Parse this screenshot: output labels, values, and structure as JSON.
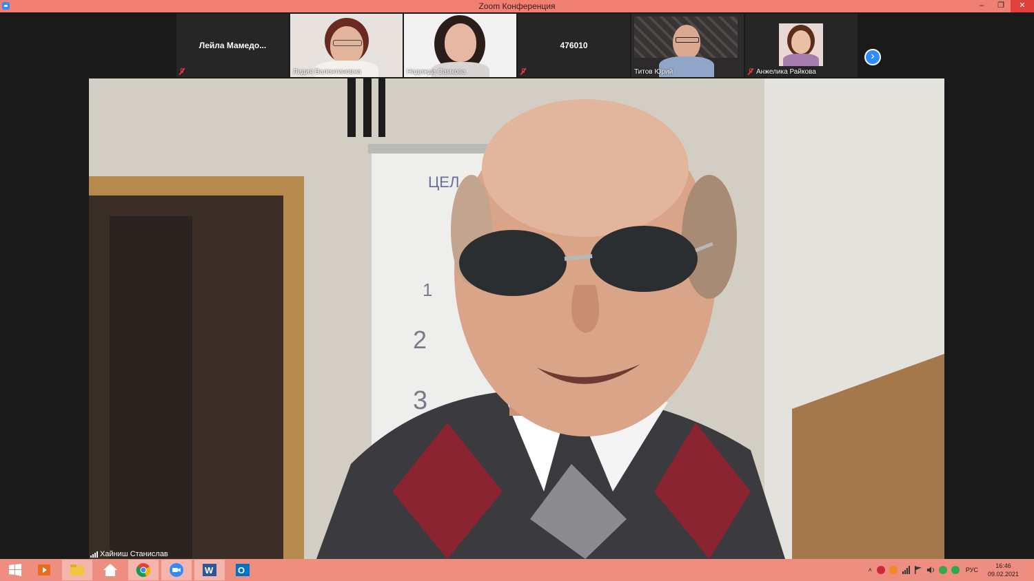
{
  "window": {
    "title": "Zoom Конференция",
    "minimize": "–",
    "maximize": "❐",
    "close": "✕"
  },
  "participants": [
    {
      "name": "Лейла Мамедо...",
      "muted": true,
      "video": false
    },
    {
      "name": "Лидия Валентиновна",
      "muted": false,
      "video": true
    },
    {
      "name": "Надежда Самкова",
      "muted": false,
      "video": true
    },
    {
      "name": "476010",
      "muted": true,
      "video": false
    },
    {
      "name": "Титов Юрий",
      "muted": false,
      "video": true
    },
    {
      "name": "Анжелика Райкова",
      "muted": true,
      "video": true
    }
  ],
  "next_page": "›",
  "active_speaker": {
    "name": "Хайниш Станислав"
  },
  "whiteboard": {
    "heading": "ЦЕЛ",
    "n1": "1",
    "n2": "2",
    "n3": "3"
  },
  "taskbar": {
    "items": [
      "start",
      "media-player",
      "file-explorer",
      "home",
      "chrome",
      "zoom",
      "word",
      "outlook"
    ],
    "language": "РУС",
    "time": "16:46",
    "date": "09.02.2021",
    "tray_caret": "˄"
  },
  "colors": {
    "titlebar": "#f07f74",
    "taskbar": "#ee8e80",
    "zoom_blue": "#2d8cff",
    "mute_red": "#e0383a"
  }
}
